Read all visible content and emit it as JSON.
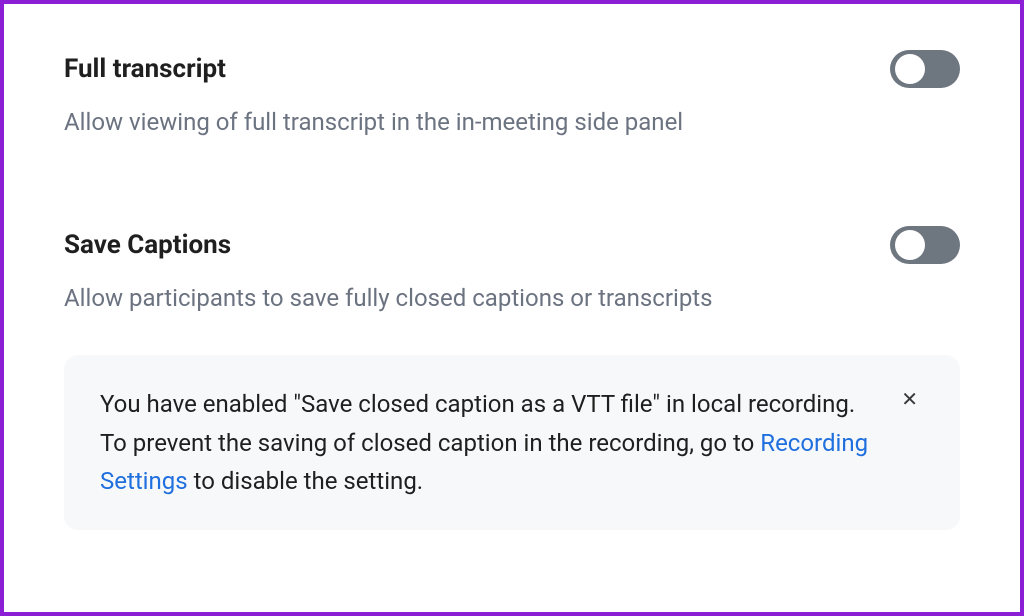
{
  "settings": [
    {
      "title": "Full transcript",
      "description": "Allow viewing of full transcript in the in-meeting side panel",
      "enabled": false
    },
    {
      "title": "Save Captions",
      "description": "Allow participants to save fully closed captions or transcripts",
      "enabled": false
    }
  ],
  "notice": {
    "text_before": "You have enabled \"Save closed caption as a VTT file\" in local recording. To prevent the saving of closed caption in the recording, go to ",
    "link_text": "Recording Settings",
    "text_after": " to disable the setting."
  },
  "colors": {
    "border": "#8b1fd6",
    "toggle_off_bg": "#6e7680",
    "link": "#1f6fde",
    "notice_bg": "#f7f8fa",
    "desc_text": "#6b7280"
  }
}
